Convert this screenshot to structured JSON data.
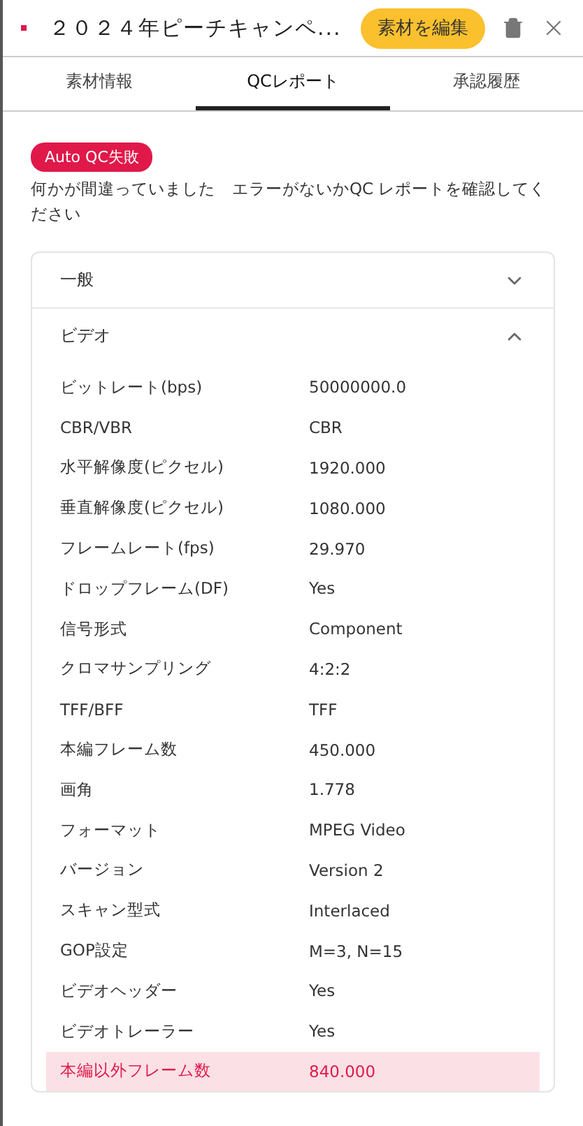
{
  "header": {
    "title": "２０２４年ピーチキャンペ...",
    "edit_button": "素材を編集"
  },
  "tabs": [
    {
      "label": "素材情報",
      "selected": false
    },
    {
      "label": "QCレポート",
      "selected": true
    },
    {
      "label": "承認履歴",
      "selected": false
    }
  ],
  "qc_badge": "Auto QC失敗",
  "message": "何かが間違っていました　エラーがないかQC レポートを確認してください",
  "sections": [
    {
      "title": "一般",
      "expanded": false
    },
    {
      "title": "ビデオ",
      "expanded": true,
      "rows": [
        {
          "label": "ビットレート(bps)",
          "value": "50000000.0",
          "error": false
        },
        {
          "label": "CBR/VBR",
          "value": "CBR",
          "error": false
        },
        {
          "label": "水平解像度(ピクセル)",
          "value": "1920.000",
          "error": false
        },
        {
          "label": "垂直解像度(ピクセル)",
          "value": "1080.000",
          "error": false
        },
        {
          "label": "フレームレート(fps)",
          "value": "29.970",
          "error": false
        },
        {
          "label": "ドロップフレーム(DF)",
          "value": "Yes",
          "error": false
        },
        {
          "label": "信号形式",
          "value": "Component",
          "error": false
        },
        {
          "label": "クロマサンプリング",
          "value": "4:2:2",
          "error": false
        },
        {
          "label": "TFF/BFF",
          "value": "TFF",
          "error": false
        },
        {
          "label": "本編フレーム数",
          "value": "450.000",
          "error": false
        },
        {
          "label": "画角",
          "value": "1.778",
          "error": false
        },
        {
          "label": "フォーマット",
          "value": "MPEG Video",
          "error": false
        },
        {
          "label": "バージョン",
          "value": "Version 2",
          "error": false
        },
        {
          "label": "スキャン型式",
          "value": "Interlaced",
          "error": false
        },
        {
          "label": "GOP設定",
          "value": "M=3, N=15",
          "error": false
        },
        {
          "label": "ビデオヘッダー",
          "value": "Yes",
          "error": false
        },
        {
          "label": "ビデオトレーラー",
          "value": "Yes",
          "error": false
        },
        {
          "label": "本編以外フレーム数",
          "value": "840.000",
          "error": true
        }
      ]
    }
  ]
}
